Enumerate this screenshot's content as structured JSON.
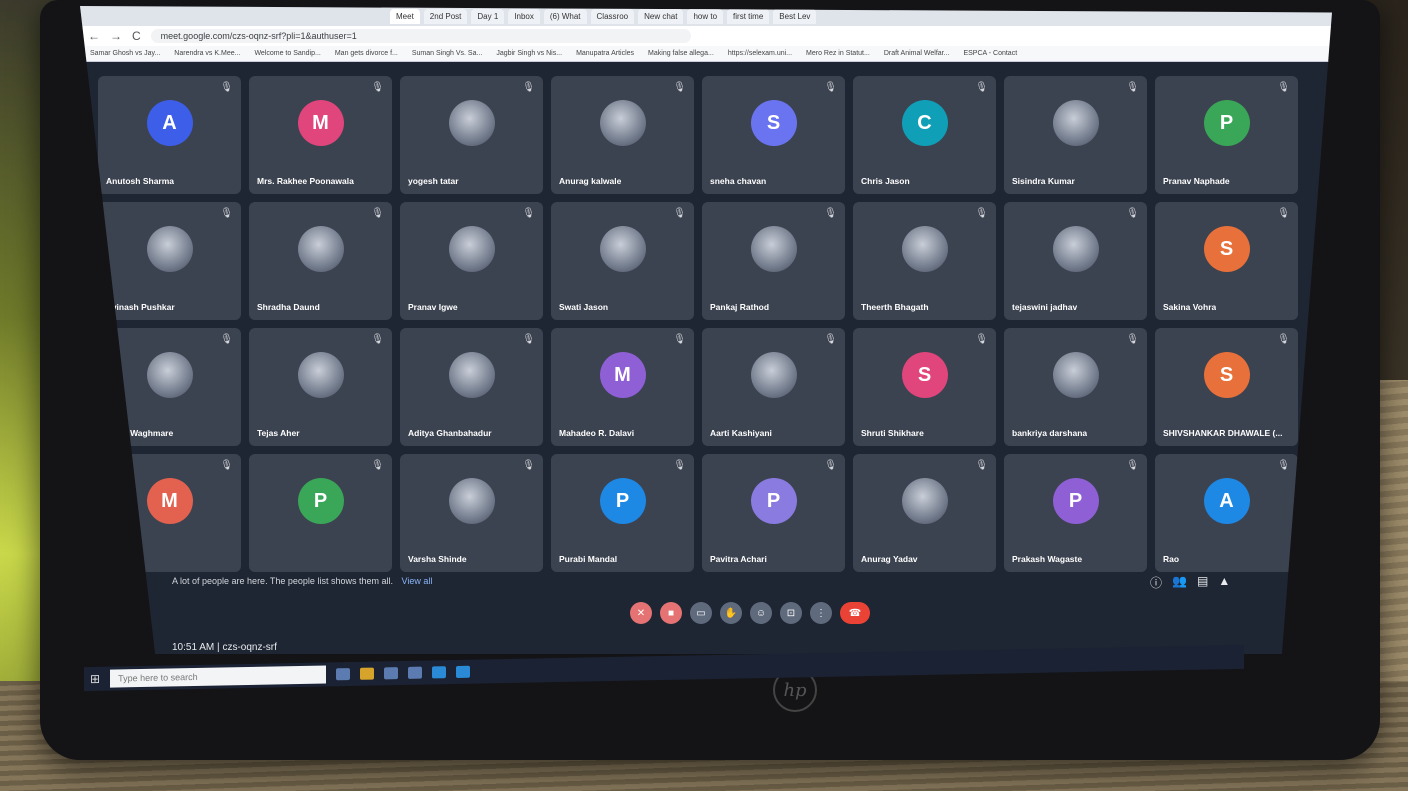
{
  "browser": {
    "tabs": [
      "Meet",
      "2nd Post",
      "Day 1",
      "Inbox",
      "(6) What",
      "Classroo",
      "New chat",
      "how to",
      "first time",
      "Best Lev"
    ],
    "url": "meet.google.com/czs-oqnz-srf?pli=1&authuser=1",
    "bookmarks": [
      "Samar Ghosh vs Jay...",
      "Narendra vs K.Mee...",
      "Welcome to Sandip...",
      "Man gets divorce f...",
      "Suman Singh Vs. Sa...",
      "Jagbir Singh vs Nis...",
      "Manupatra Articles",
      "Making false allega...",
      "https://selexam.uni...",
      "Mero Rez in Statut...",
      "Draft Animal Welfar...",
      "ESPCA - Contact"
    ]
  },
  "participants": [
    {
      "name": "Anutosh Sharma",
      "initial": "A",
      "color": "#3c5ee8",
      "photo": false
    },
    {
      "name": "Mrs. Rakhee Poonawala",
      "initial": "M",
      "color": "#e0457b",
      "photo": false
    },
    {
      "name": "yogesh tatar",
      "initial": "",
      "color": "",
      "photo": true
    },
    {
      "name": "Anurag kalwale",
      "initial": "",
      "color": "",
      "photo": true
    },
    {
      "name": "sneha chavan",
      "initial": "S",
      "color": "#6a74f0",
      "photo": false
    },
    {
      "name": "Chris Jason",
      "initial": "C",
      "color": "#0fa0b8",
      "photo": false
    },
    {
      "name": "Sisindra Kumar",
      "initial": "",
      "color": "",
      "photo": true
    },
    {
      "name": "Pranav Naphade",
      "initial": "P",
      "color": "#3aa657",
      "photo": false
    },
    {
      "name": "Avinash Pushkar",
      "initial": "",
      "color": "",
      "photo": true
    },
    {
      "name": "Shradha Daund",
      "initial": "",
      "color": "",
      "photo": true
    },
    {
      "name": "Pranav Igwe",
      "initial": "",
      "color": "",
      "photo": true
    },
    {
      "name": "Swati Jason",
      "initial": "",
      "color": "",
      "photo": true
    },
    {
      "name": "Pankaj Rathod",
      "initial": "",
      "color": "",
      "photo": true
    },
    {
      "name": "Theerth Bhagath",
      "initial": "",
      "color": "",
      "photo": true
    },
    {
      "name": "tejaswini jadhav",
      "initial": "",
      "color": "",
      "photo": true
    },
    {
      "name": "Sakina Vohra",
      "initial": "S",
      "color": "#e8703a",
      "photo": false
    },
    {
      "name": "Rohit Waghmare",
      "initial": "",
      "color": "",
      "photo": true
    },
    {
      "name": "Tejas Aher",
      "initial": "",
      "color": "",
      "photo": true
    },
    {
      "name": "Aditya Ghanbahadur",
      "initial": "",
      "color": "",
      "photo": true
    },
    {
      "name": "Mahadeo R. Dalavi",
      "initial": "M",
      "color": "#8f5fd6",
      "photo": false
    },
    {
      "name": "Aarti Kashiyani",
      "initial": "",
      "color": "",
      "photo": true
    },
    {
      "name": "Shruti Shikhare",
      "initial": "S",
      "color": "#e0457b",
      "photo": false
    },
    {
      "name": "bankriya darshana",
      "initial": "",
      "color": "",
      "photo": true
    },
    {
      "name": "SHIVSHANKAR DHAWALE (...",
      "initial": "S",
      "color": "#e8703a",
      "photo": false
    },
    {
      "name": "",
      "initial": "M",
      "color": "#e2624f",
      "photo": false
    },
    {
      "name": "",
      "initial": "P",
      "color": "#3aa657",
      "photo": false
    },
    {
      "name": "Varsha Shinde",
      "initial": "",
      "color": "",
      "photo": true
    },
    {
      "name": "Purabi Mandal",
      "initial": "P",
      "color": "#1e88e5",
      "photo": false
    },
    {
      "name": "Pavitra Achari",
      "initial": "P",
      "color": "#8a7be0",
      "photo": false
    },
    {
      "name": "Anurag Yadav",
      "initial": "",
      "color": "",
      "photo": true
    },
    {
      "name": "Prakash Wagaste",
      "initial": "P",
      "color": "#8f5fd6",
      "photo": false
    },
    {
      "name": "Rao",
      "initial": "A",
      "color": "#1e88e5",
      "photo": false
    }
  ],
  "notice": {
    "text": "A lot of people are here. The people list shows them all.",
    "link": "View all"
  },
  "meeting": {
    "time": "10:51 AM",
    "separator": "|",
    "code": "czs-oqnz-srf"
  },
  "taskbar": {
    "search_placeholder": "Type here to search"
  }
}
